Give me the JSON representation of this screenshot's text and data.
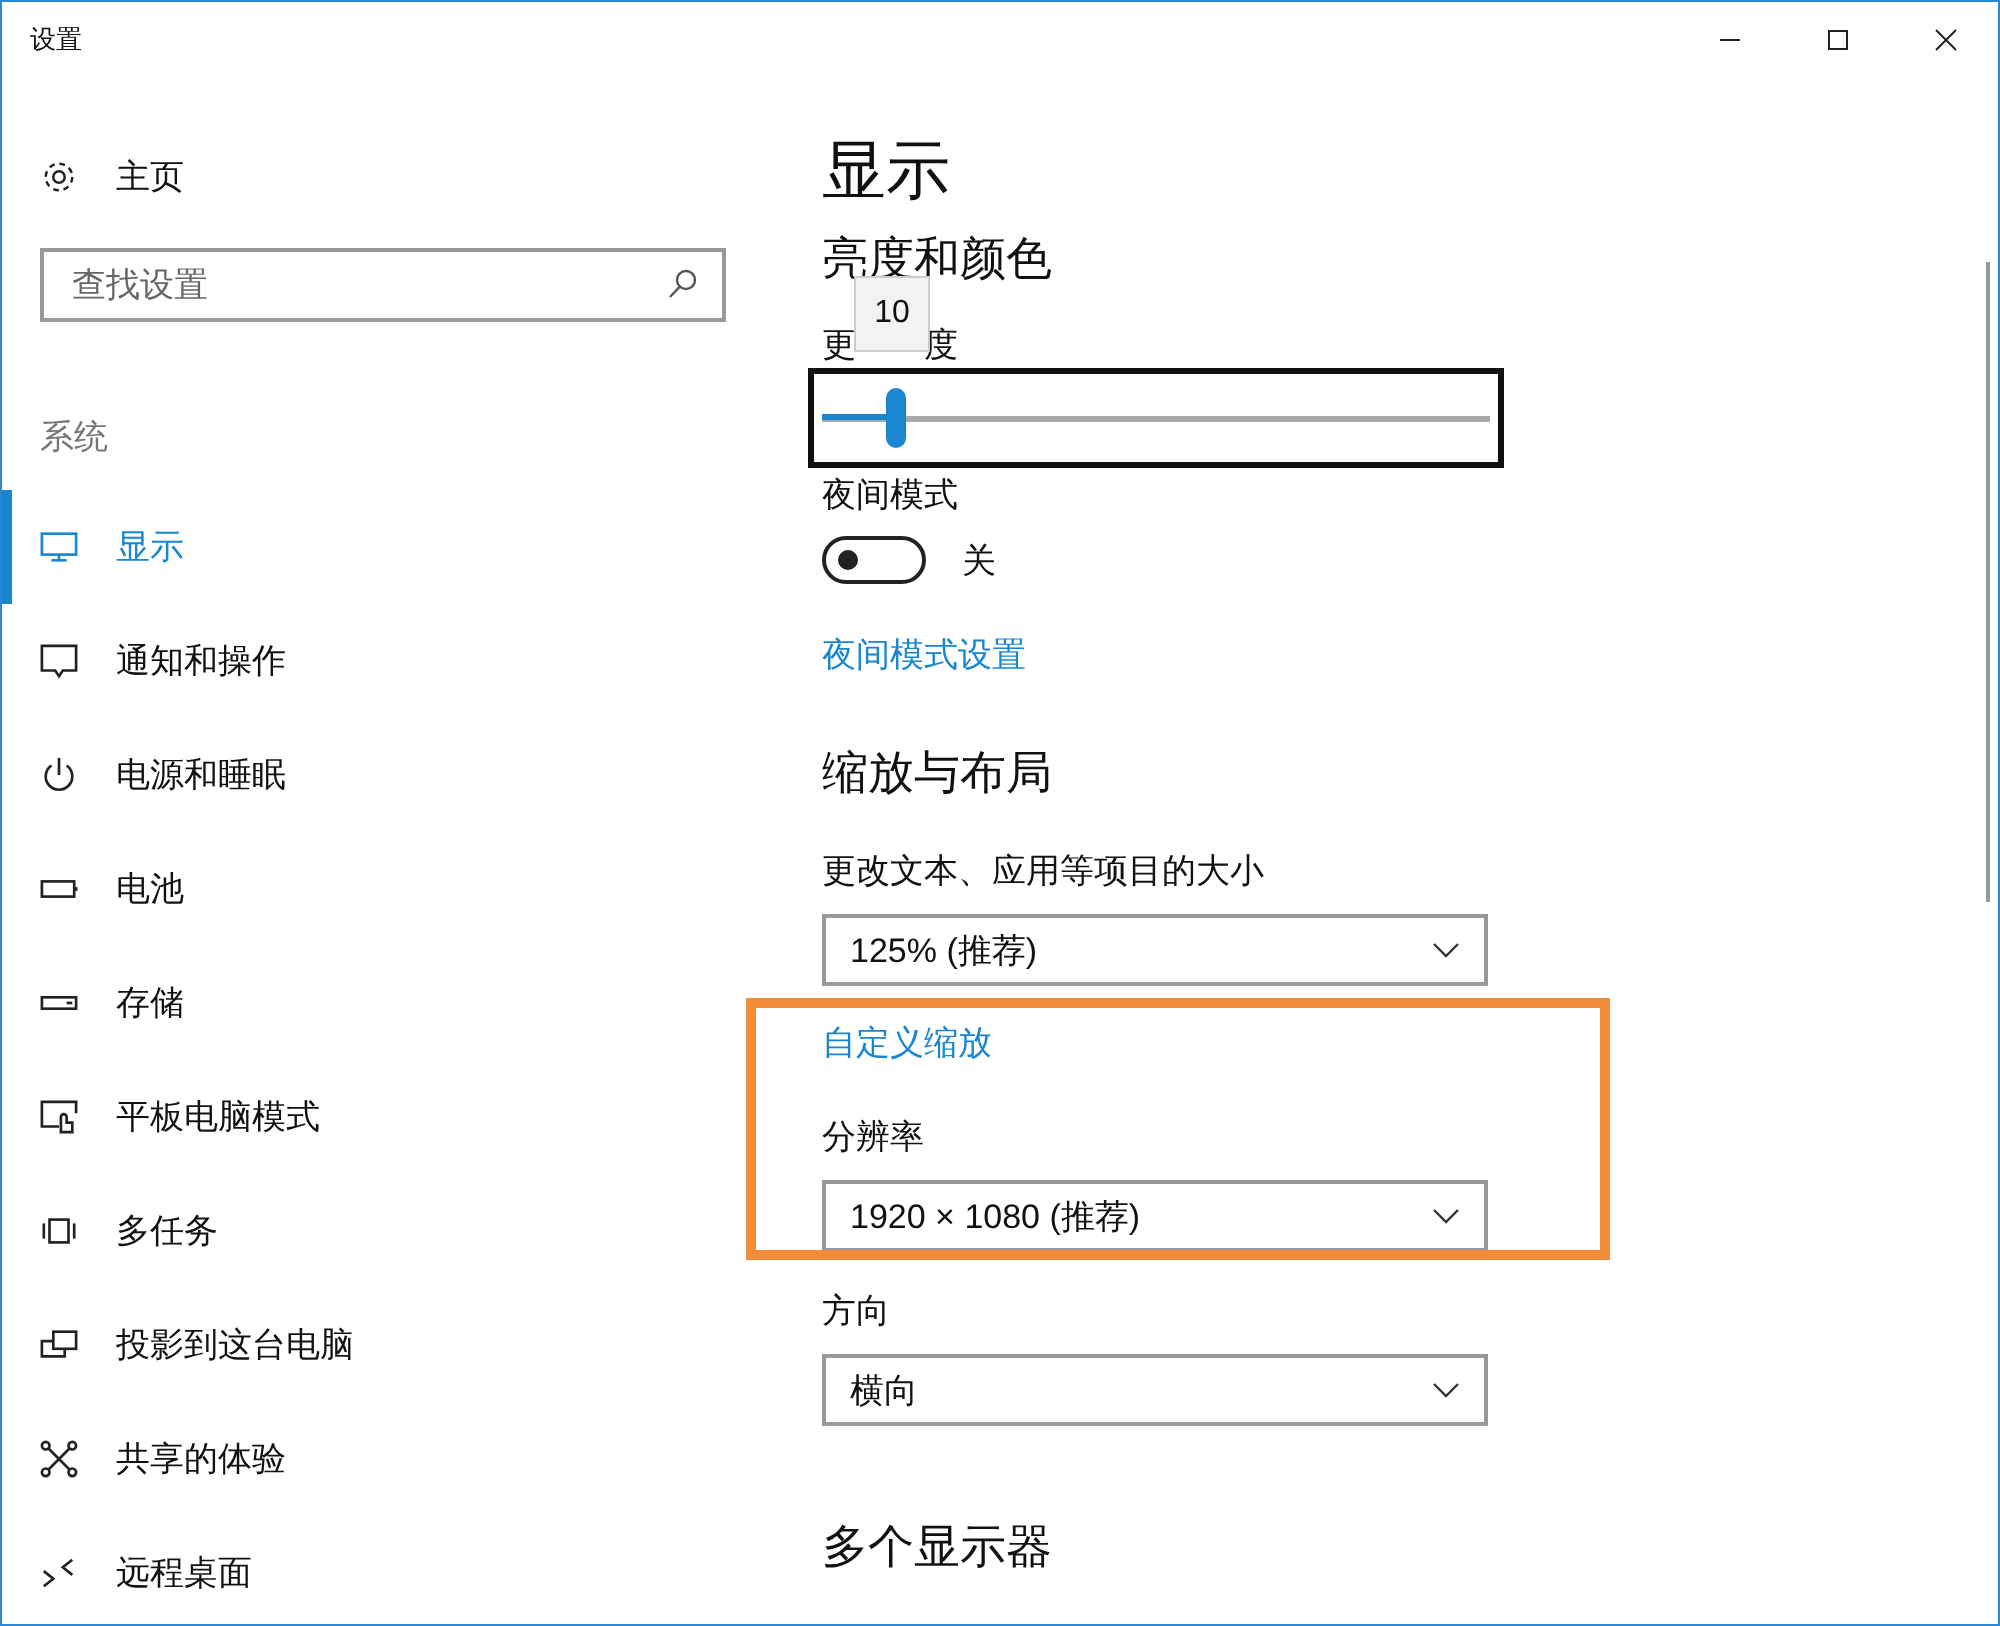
{
  "window": {
    "title": "设置"
  },
  "sidebar": {
    "home": {
      "label": "主页"
    },
    "search": {
      "placeholder": "查找设置"
    },
    "section": "系统",
    "items": [
      {
        "label": "显示",
        "selected": true
      },
      {
        "label": "通知和操作",
        "selected": false
      },
      {
        "label": "电源和睡眠",
        "selected": false
      },
      {
        "label": "电池",
        "selected": false
      },
      {
        "label": "存储",
        "selected": false
      },
      {
        "label": "平板电脑模式",
        "selected": false
      },
      {
        "label": "多任务",
        "selected": false
      },
      {
        "label": "投影到这台电脑",
        "selected": false
      },
      {
        "label": "共享的体验",
        "selected": false
      },
      {
        "label": "远程桌面",
        "selected": false
      }
    ]
  },
  "content": {
    "title": "显示",
    "brightness": {
      "heading": "亮度和颜色",
      "label_start": "更",
      "label_end": "度",
      "tooltip": "10",
      "level": 0.11
    },
    "night_mode": {
      "label": "夜间模式",
      "on": false,
      "state_text": "关",
      "link": "夜间模式设置"
    },
    "scale": {
      "heading": "缩放与布局",
      "size_label": "更改文本、应用等项目的大小",
      "size_value": "125% (推荐)",
      "custom_link": "自定义缩放",
      "resolution_label": "分辨率",
      "resolution_value": "1920 × 1080 (推荐)",
      "orientation_label": "方向",
      "orientation_value": "横向"
    },
    "multi_heading": "多个显示器"
  }
}
